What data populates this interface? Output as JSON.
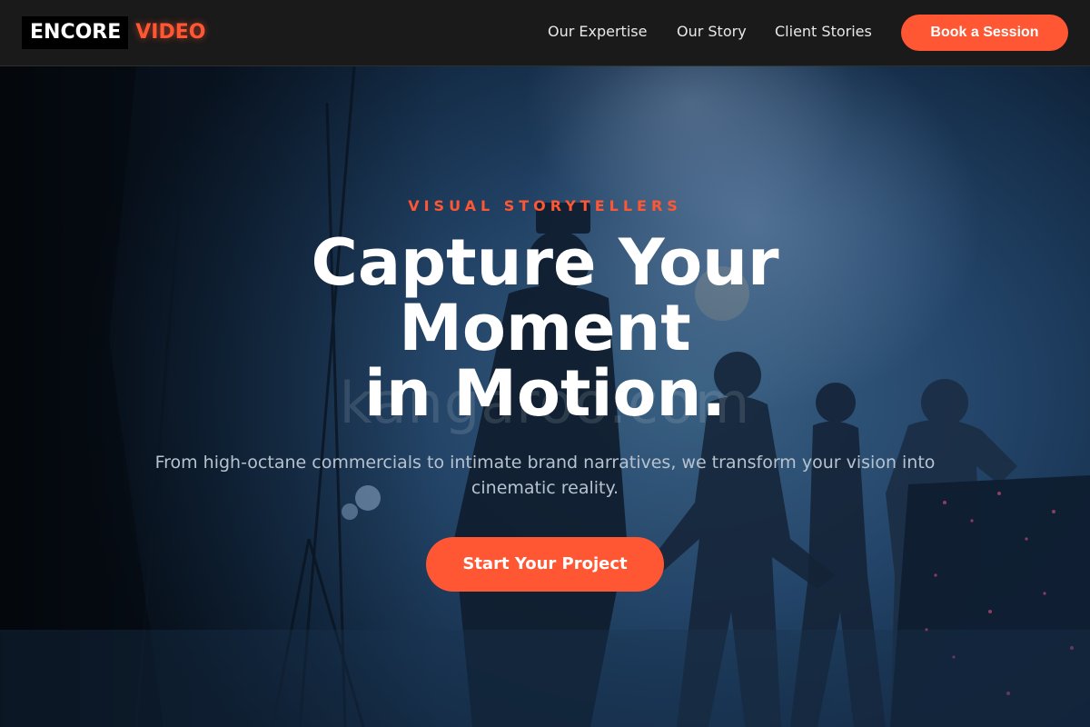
{
  "brand": {
    "part1": "ENCORE",
    "part2": "VIDEO",
    "accent": "#ff5733"
  },
  "nav": {
    "links": [
      {
        "label": "Our Expertise"
      },
      {
        "label": "Our Story"
      },
      {
        "label": "Client Stories"
      }
    ],
    "cta_label": "Book a Session"
  },
  "hero": {
    "tagline": "VISUAL STORYTELLERS",
    "headline_lines": [
      "Capture Your",
      "Moment",
      "in Motion."
    ],
    "watermark": "kangaroo.com",
    "subtitle": "From high-octane commercials to intimate brand narratives, we transform your vision into cinematic reality.",
    "cta_label": "Start Your Project"
  }
}
